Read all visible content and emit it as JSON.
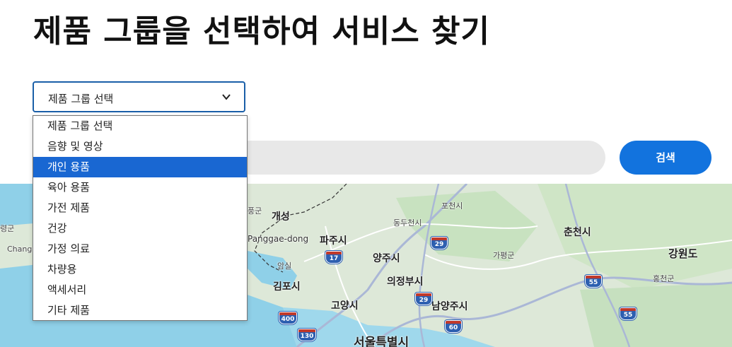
{
  "page": {
    "title": "제품 그룹을 선택하여 서비스 찾기"
  },
  "select": {
    "value": "제품 그룹 선택",
    "options": [
      "제품 그룹 선택",
      "음향 및 영상",
      "개인 용품",
      "육아 용품",
      "가전 제품",
      "건강",
      "가정 의료",
      "차량용",
      "액세서리",
      "기타 제품"
    ],
    "highlighted": "개인 용품"
  },
  "search": {
    "button_label": "검색"
  },
  "map": {
    "labels": {
      "gaeseong": "개성",
      "panggae": "Panggae-dong",
      "paju": "파주시",
      "yangju": "양주시",
      "uijeongbu": "의정부시",
      "namyangju": "남양주시",
      "goyang": "고양시",
      "gimpo": "김포시",
      "seoul": "서울특별시",
      "chuncheon": "춘천시",
      "gangwon": "강원도",
      "hongcheon": "홍천군",
      "gapyeong": "가평군",
      "pocheon": "포천시",
      "dongducheon": "동두천시",
      "amsil": "암실",
      "gun_left": "령군",
      "chang": "Changs",
      "gun_mid": "풍군"
    },
    "shields": {
      "r17": "17",
      "r29a": "29",
      "r29b": "29",
      "r55a": "55",
      "r55b": "55",
      "r400": "400",
      "r130": "130",
      "r60": "60"
    },
    "colors": {
      "land": "#dde8d8",
      "water": "#8fd0e8",
      "road": "#ffffff",
      "highway": "#aab7d6",
      "border": "#333333"
    }
  }
}
